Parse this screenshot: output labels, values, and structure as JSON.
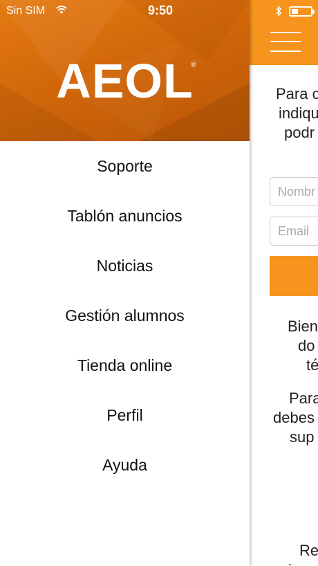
{
  "status_bar": {
    "carrier": "Sin SIM",
    "time": "9:50",
    "icons": [
      "wifi-icon",
      "bluetooth-icon",
      "battery-icon"
    ],
    "battery_level": 0.35
  },
  "drawer": {
    "logo_text": "AEOL",
    "logo_mark": "®",
    "menu": [
      {
        "label": "Soporte"
      },
      {
        "label": "Tablón anuncios"
      },
      {
        "label": "Noticias"
      },
      {
        "label": "Gestión alumnos"
      },
      {
        "label": "Tienda online"
      },
      {
        "label": "Perfil"
      },
      {
        "label": "Ayuda"
      }
    ]
  },
  "main": {
    "menu_icon": "hamburger-icon",
    "intro_lines": [
      "Para c",
      "indiqu",
      "podr"
    ],
    "name_placeholder": "Nombr",
    "email_placeholder": "Email",
    "para1_lines": [
      "Bien",
      "do",
      "té"
    ],
    "para2_lines": [
      "Para",
      "debes",
      "sup"
    ],
    "para3_lines": [
      "Re",
      "i..."
    ]
  },
  "colors": {
    "accent": "#f7941d",
    "header_dark": "#b95606",
    "header_light": "#e57b12",
    "text": "#111111"
  }
}
